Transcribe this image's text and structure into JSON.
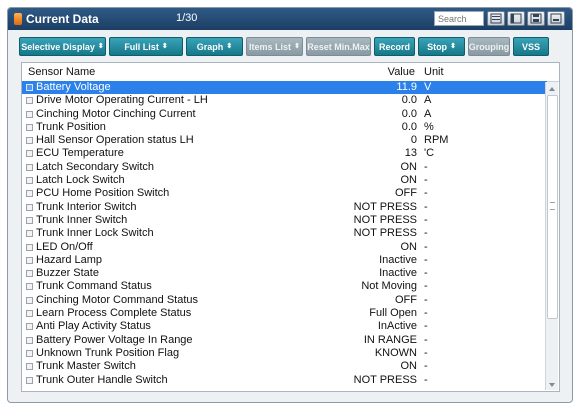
{
  "window": {
    "title": "Current Data",
    "count": "1/30"
  },
  "search": {
    "placeholder": "Search"
  },
  "toolbar": {
    "selective_display": "Selective Display",
    "full_list": "Full List",
    "graph": "Graph",
    "items_list": "Items List",
    "reset_min_max": "Reset Min.Max",
    "record": "Record",
    "stop": "Stop",
    "grouping": "Grouping",
    "vss": "VSS"
  },
  "table": {
    "headers": {
      "name": "Sensor Name",
      "value": "Value",
      "unit": "Unit"
    },
    "rows": [
      {
        "name": "Battery Voltage",
        "value": "11.9",
        "unit": "V"
      },
      {
        "name": "Drive Motor Operating Current - LH",
        "value": "0.0",
        "unit": "A"
      },
      {
        "name": "Cinching Motor Cinching Current",
        "value": "0.0",
        "unit": "A"
      },
      {
        "name": "Trunk Position",
        "value": "0.0",
        "unit": "%"
      },
      {
        "name": "Hall Sensor Operation status LH",
        "value": "0",
        "unit": "RPM"
      },
      {
        "name": "ECU Temperature",
        "value": "13",
        "unit": "'C"
      },
      {
        "name": "Latch Secondary Switch",
        "value": "ON",
        "unit": "-"
      },
      {
        "name": "Latch Lock Switch",
        "value": "ON",
        "unit": "-"
      },
      {
        "name": "PCU Home Position Switch",
        "value": "OFF",
        "unit": "-"
      },
      {
        "name": "Trunk Interior Switch",
        "value": "NOT PRESS",
        "unit": "-"
      },
      {
        "name": "Trunk Inner Switch",
        "value": "NOT PRESS",
        "unit": "-"
      },
      {
        "name": "Trunk Inner Lock Switch",
        "value": "NOT PRESS",
        "unit": "-"
      },
      {
        "name": "LED On/Off",
        "value": "ON",
        "unit": "-"
      },
      {
        "name": "Hazard Lamp",
        "value": "Inactive",
        "unit": "-"
      },
      {
        "name": "Buzzer State",
        "value": "Inactive",
        "unit": "-"
      },
      {
        "name": "Trunk Command Status",
        "value": "Not Moving",
        "unit": "-"
      },
      {
        "name": "Cinching Motor Command Status",
        "value": "OFF",
        "unit": "-"
      },
      {
        "name": "Learn Process Complete Status",
        "value": "Full Open",
        "unit": "-"
      },
      {
        "name": "Anti Play Activity Status",
        "value": "InActive",
        "unit": "-"
      },
      {
        "name": "Battery Power Voltage In Range",
        "value": "IN RANGE",
        "unit": "-"
      },
      {
        "name": "Unknown Trunk Position Flag",
        "value": "KNOWN",
        "unit": "-"
      },
      {
        "name": "Trunk Master Switch",
        "value": "ON",
        "unit": "-"
      },
      {
        "name": "Trunk Outer Handle Switch",
        "value": "NOT PRESS",
        "unit": "-"
      }
    ]
  }
}
